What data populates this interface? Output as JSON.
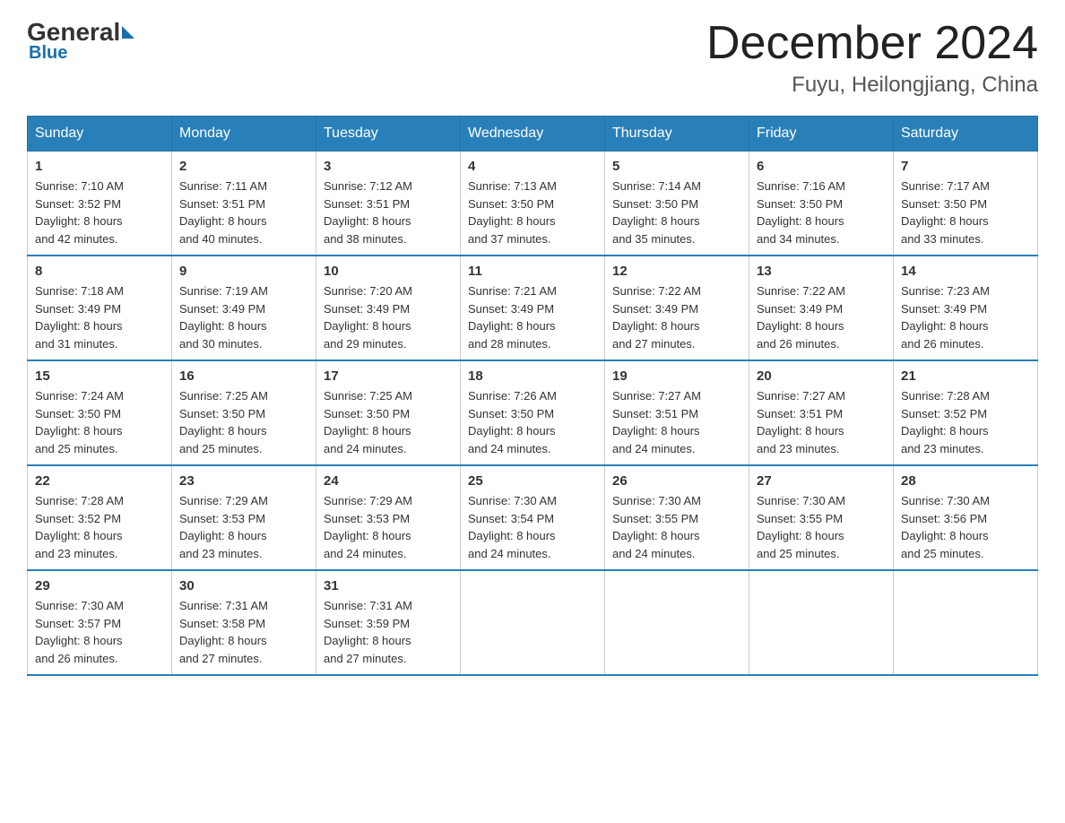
{
  "logo": {
    "general": "General",
    "blue": "Blue"
  },
  "header": {
    "month": "December 2024",
    "location": "Fuyu, Heilongjiang, China"
  },
  "days_of_week": [
    "Sunday",
    "Monday",
    "Tuesday",
    "Wednesday",
    "Thursday",
    "Friday",
    "Saturday"
  ],
  "weeks": [
    [
      {
        "day": "1",
        "sunrise": "7:10 AM",
        "sunset": "3:52 PM",
        "daylight": "8 hours and 42 minutes."
      },
      {
        "day": "2",
        "sunrise": "7:11 AM",
        "sunset": "3:51 PM",
        "daylight": "8 hours and 40 minutes."
      },
      {
        "day": "3",
        "sunrise": "7:12 AM",
        "sunset": "3:51 PM",
        "daylight": "8 hours and 38 minutes."
      },
      {
        "day": "4",
        "sunrise": "7:13 AM",
        "sunset": "3:50 PM",
        "daylight": "8 hours and 37 minutes."
      },
      {
        "day": "5",
        "sunrise": "7:14 AM",
        "sunset": "3:50 PM",
        "daylight": "8 hours and 35 minutes."
      },
      {
        "day": "6",
        "sunrise": "7:16 AM",
        "sunset": "3:50 PM",
        "daylight": "8 hours and 34 minutes."
      },
      {
        "day": "7",
        "sunrise": "7:17 AM",
        "sunset": "3:50 PM",
        "daylight": "8 hours and 33 minutes."
      }
    ],
    [
      {
        "day": "8",
        "sunrise": "7:18 AM",
        "sunset": "3:49 PM",
        "daylight": "8 hours and 31 minutes."
      },
      {
        "day": "9",
        "sunrise": "7:19 AM",
        "sunset": "3:49 PM",
        "daylight": "8 hours and 30 minutes."
      },
      {
        "day": "10",
        "sunrise": "7:20 AM",
        "sunset": "3:49 PM",
        "daylight": "8 hours and 29 minutes."
      },
      {
        "day": "11",
        "sunrise": "7:21 AM",
        "sunset": "3:49 PM",
        "daylight": "8 hours and 28 minutes."
      },
      {
        "day": "12",
        "sunrise": "7:22 AM",
        "sunset": "3:49 PM",
        "daylight": "8 hours and 27 minutes."
      },
      {
        "day": "13",
        "sunrise": "7:22 AM",
        "sunset": "3:49 PM",
        "daylight": "8 hours and 26 minutes."
      },
      {
        "day": "14",
        "sunrise": "7:23 AM",
        "sunset": "3:49 PM",
        "daylight": "8 hours and 26 minutes."
      }
    ],
    [
      {
        "day": "15",
        "sunrise": "7:24 AM",
        "sunset": "3:50 PM",
        "daylight": "8 hours and 25 minutes."
      },
      {
        "day": "16",
        "sunrise": "7:25 AM",
        "sunset": "3:50 PM",
        "daylight": "8 hours and 25 minutes."
      },
      {
        "day": "17",
        "sunrise": "7:25 AM",
        "sunset": "3:50 PM",
        "daylight": "8 hours and 24 minutes."
      },
      {
        "day": "18",
        "sunrise": "7:26 AM",
        "sunset": "3:50 PM",
        "daylight": "8 hours and 24 minutes."
      },
      {
        "day": "19",
        "sunrise": "7:27 AM",
        "sunset": "3:51 PM",
        "daylight": "8 hours and 24 minutes."
      },
      {
        "day": "20",
        "sunrise": "7:27 AM",
        "sunset": "3:51 PM",
        "daylight": "8 hours and 23 minutes."
      },
      {
        "day": "21",
        "sunrise": "7:28 AM",
        "sunset": "3:52 PM",
        "daylight": "8 hours and 23 minutes."
      }
    ],
    [
      {
        "day": "22",
        "sunrise": "7:28 AM",
        "sunset": "3:52 PM",
        "daylight": "8 hours and 23 minutes."
      },
      {
        "day": "23",
        "sunrise": "7:29 AM",
        "sunset": "3:53 PM",
        "daylight": "8 hours and 23 minutes."
      },
      {
        "day": "24",
        "sunrise": "7:29 AM",
        "sunset": "3:53 PM",
        "daylight": "8 hours and 24 minutes."
      },
      {
        "day": "25",
        "sunrise": "7:30 AM",
        "sunset": "3:54 PM",
        "daylight": "8 hours and 24 minutes."
      },
      {
        "day": "26",
        "sunrise": "7:30 AM",
        "sunset": "3:55 PM",
        "daylight": "8 hours and 24 minutes."
      },
      {
        "day": "27",
        "sunrise": "7:30 AM",
        "sunset": "3:55 PM",
        "daylight": "8 hours and 25 minutes."
      },
      {
        "day": "28",
        "sunrise": "7:30 AM",
        "sunset": "3:56 PM",
        "daylight": "8 hours and 25 minutes."
      }
    ],
    [
      {
        "day": "29",
        "sunrise": "7:30 AM",
        "sunset": "3:57 PM",
        "daylight": "8 hours and 26 minutes."
      },
      {
        "day": "30",
        "sunrise": "7:31 AM",
        "sunset": "3:58 PM",
        "daylight": "8 hours and 27 minutes."
      },
      {
        "day": "31",
        "sunrise": "7:31 AM",
        "sunset": "3:59 PM",
        "daylight": "8 hours and 27 minutes."
      },
      null,
      null,
      null,
      null
    ]
  ],
  "labels": {
    "sunrise": "Sunrise:",
    "sunset": "Sunset:",
    "daylight": "Daylight:"
  }
}
